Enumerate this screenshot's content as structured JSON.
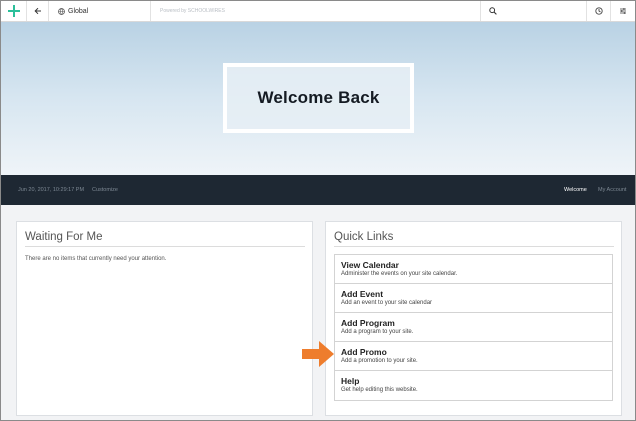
{
  "toolbar": {
    "site_label": "Global",
    "powered_by": "Powered by SCHOOLWIRES"
  },
  "hero": {
    "title": "Welcome Back"
  },
  "navbar": {
    "datetime": "Jun 20, 2017, 10:29:17 PM",
    "customize": "Customize",
    "welcome": "Welcome",
    "my_account": "My Account"
  },
  "waiting": {
    "title": "Waiting For Me",
    "message": "There are no items that currently need your attention."
  },
  "quick_links": {
    "title": "Quick Links",
    "items": [
      {
        "title": "View Calendar",
        "desc": "Administer the events on your site calendar."
      },
      {
        "title": "Add Event",
        "desc": "Add an event to your site calendar"
      },
      {
        "title": "Add Program",
        "desc": "Add a program to your site."
      },
      {
        "title": "Add Promo",
        "desc": "Add a promotion to your site."
      },
      {
        "title": "Help",
        "desc": "Get help editing this website."
      }
    ]
  },
  "colors": {
    "accent": "#2bbf9a",
    "nav_bg": "#1e2833",
    "arrow": "#ee7d2d"
  },
  "icons": [
    "plus-logo-icon",
    "back-arrow-icon",
    "globe-icon",
    "search-icon",
    "history-icon",
    "settings-sliders-icon",
    "pointer-arrow-icon"
  ]
}
